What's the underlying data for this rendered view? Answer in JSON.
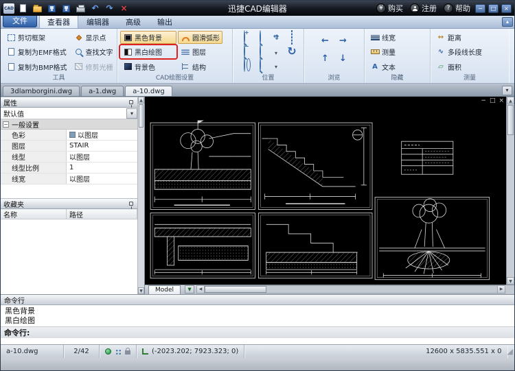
{
  "window": {
    "title": "迅捷CAD编辑器"
  },
  "titlebar": {
    "logo_text": "CAD",
    "buy_label": "购买",
    "register_label": "注册",
    "help_label": "帮助"
  },
  "menubar": {
    "file_label": "文件",
    "tabs": [
      {
        "label": "查看器"
      },
      {
        "label": "编辑器"
      },
      {
        "label": "高级"
      },
      {
        "label": "输出"
      }
    ]
  },
  "ribbon": {
    "tools": {
      "label": "工具",
      "clip_frame": "剪切框架",
      "copy_emf": "复制为EMF格式",
      "copy_bmp": "复制为BMP格式",
      "show_points": "显示点",
      "find_text": "查找文字",
      "trim_raster": "修剪光栅"
    },
    "cad_settings": {
      "label": "CAD绘图设置",
      "black_bg": "黑色背景",
      "smooth_arc": "圆滑弧形",
      "bw_drawing": "黑白绘图",
      "layers": "图层",
      "bg_color": "背景色",
      "structure": "结构"
    },
    "position": {
      "label": "位置"
    },
    "browse": {
      "label": "浏览"
    },
    "hide": {
      "label": "隐藏",
      "lineweight": "线宽",
      "measure": "测量",
      "text": "文本"
    },
    "measure": {
      "label": "测量",
      "distance": "距离",
      "polyline_length": "多段线长度",
      "area": "面积"
    }
  },
  "doc_tabs": [
    {
      "label": "3dlamborgini.dwg"
    },
    {
      "label": "a-1.dwg"
    },
    {
      "label": "a-10.dwg"
    }
  ],
  "properties": {
    "title": "属性",
    "selector_value": "默认值",
    "group_label": "一般设置",
    "rows": [
      {
        "label": "色彩",
        "value": "以图层",
        "swatch_css": "background:#7f9db9"
      },
      {
        "label": "图层",
        "value": "STAIR"
      },
      {
        "label": "线型",
        "value": "以图层"
      },
      {
        "label": "线型比例",
        "value": "1"
      },
      {
        "label": "线宽",
        "value": "以图层"
      }
    ]
  },
  "favorites": {
    "title": "收藏夹",
    "col_name": "名称",
    "col_path": "路径"
  },
  "canvas": {
    "model_tab": "Model"
  },
  "command": {
    "title": "命令行",
    "history": [
      {
        "text": "黑色背景"
      },
      {
        "text": "黑白绘图"
      }
    ],
    "prompt": "命令行:"
  },
  "statusbar": {
    "file": "a-10.dwg",
    "page": "2/42",
    "coordinates": "(-2023.202; 7923.323; 0)",
    "dimensions": "12600 x 5835.551 x 0"
  },
  "icons": {
    "dropdown": "▾",
    "tree_collapse": "−",
    "undo": "↶",
    "redo": "↷",
    "close": "×",
    "minimize": "−",
    "maximize": "□",
    "yen": "¥",
    "question": "?",
    "ribbon_toggle": "▴",
    "arrow_left": "←",
    "arrow_right": "→",
    "arrow_up": "↑",
    "arrow_down": "↓",
    "scroll_up": "▲",
    "scroll_down": "▼",
    "scroll_left": "◀",
    "scroll_right": "▶",
    "text_a": "A",
    "distance": "↔",
    "polyline": "∿",
    "area": "▱",
    "rotate": "↻",
    "grip": "◢"
  },
  "colors": {
    "toggle_highlight": "#f5d88f",
    "toggle_border": "#caa04e",
    "annotation": "#e01f1f",
    "canvas_bg": "#000000"
  }
}
